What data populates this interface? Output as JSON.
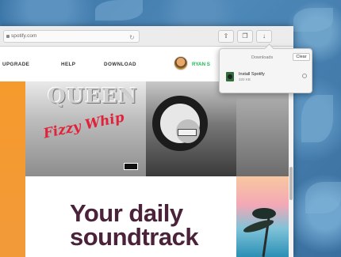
{
  "browser": {
    "url": "spotify.com"
  },
  "nav": {
    "items": [
      "UPGRADE",
      "HELP",
      "DOWNLOAD"
    ],
    "user": "RYAN S"
  },
  "albums": {
    "queen_title": "QUEEN",
    "queen_sub": "Fizzy Whip"
  },
  "hero": {
    "tagline": "Your daily soundtrack"
  },
  "downloads": {
    "title": "Downloads",
    "clear_label": "Clear",
    "items": [
      {
        "name": "Install Spotify",
        "size": "320 KB"
      }
    ]
  }
}
